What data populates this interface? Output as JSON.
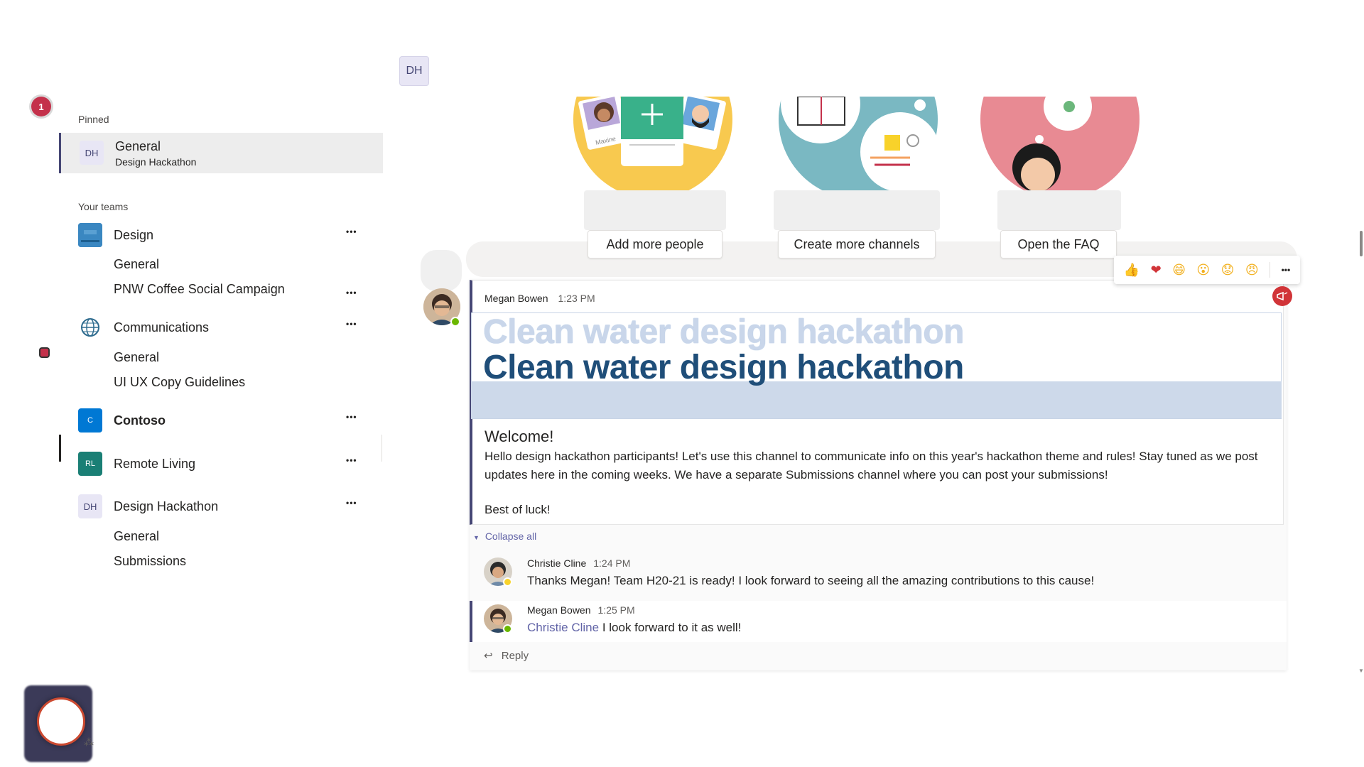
{
  "rail": {
    "notification_count": "1"
  },
  "pinned": {
    "label": "Pinned",
    "item": {
      "avatar": "DH",
      "title": "General",
      "subtitle": "Design Hackathon"
    }
  },
  "teams": {
    "label": "Your teams",
    "more": "•••",
    "list": [
      {
        "name": "Design",
        "channels": [
          "General",
          "PNW Coffee Social Campaign"
        ]
      },
      {
        "name": "Communications",
        "channels": [
          "General",
          "UI UX Copy Guidelines"
        ]
      },
      {
        "name": "Contoso",
        "avatar": "C"
      },
      {
        "name": "Remote Living",
        "avatar": "RL"
      },
      {
        "name": "Design Hackathon",
        "avatar": "DH",
        "channels": [
          "General",
          "Submissions"
        ]
      }
    ]
  },
  "header": {
    "team_avatar": "DH"
  },
  "welcome_cards": {
    "buttons": [
      "Add more people",
      "Create more channels",
      "Open the FAQ"
    ],
    "card_name_tag": "Maxine"
  },
  "reactions": {
    "icons": [
      "like-icon",
      "heart-icon",
      "laugh-icon",
      "surprised-icon",
      "sad-icon",
      "angry-icon",
      "more-options-icon"
    ],
    "glyphs": [
      "👍",
      "❤",
      "😄",
      "😮",
      "😟",
      "😠"
    ],
    "more": "•••"
  },
  "post": {
    "author": "Megan Bowen",
    "time": "1:23 PM",
    "hero_title": "Clean water design hackathon",
    "heading": "Welcome!",
    "body": "Hello design hackathon participants! Let's use this channel to communicate info on this year's hackathon theme and rules! Stay tuned as we post updates here in the coming weeks. We have a separate Submissions channel where you can post your submissions!",
    "signoff": "Best of luck!"
  },
  "thread": {
    "collapse_label": "Collapse all",
    "replies": [
      {
        "author": "Christie Cline",
        "time": "1:24 PM",
        "text": "Thanks Megan! Team H20-21 is ready! I look forward to seeing all the amazing contributions to this cause!"
      },
      {
        "author": "Megan Bowen",
        "time": "1:25 PM",
        "mention": "Christie Cline",
        "text": " I look forward to it as well!"
      }
    ],
    "reply_label": "Reply"
  },
  "colors": {
    "accent": "#464775",
    "brand_link": "#6264a7",
    "hero_title": "#1f4e79",
    "hero_band": "#cdd9ea",
    "notification": "#c4314b",
    "card_yellow": "#f8c94f",
    "card_teal": "#7ab8c2",
    "card_pink": "#e88a93",
    "status_available": "#6bb700",
    "status_away": "#f8d22a"
  }
}
